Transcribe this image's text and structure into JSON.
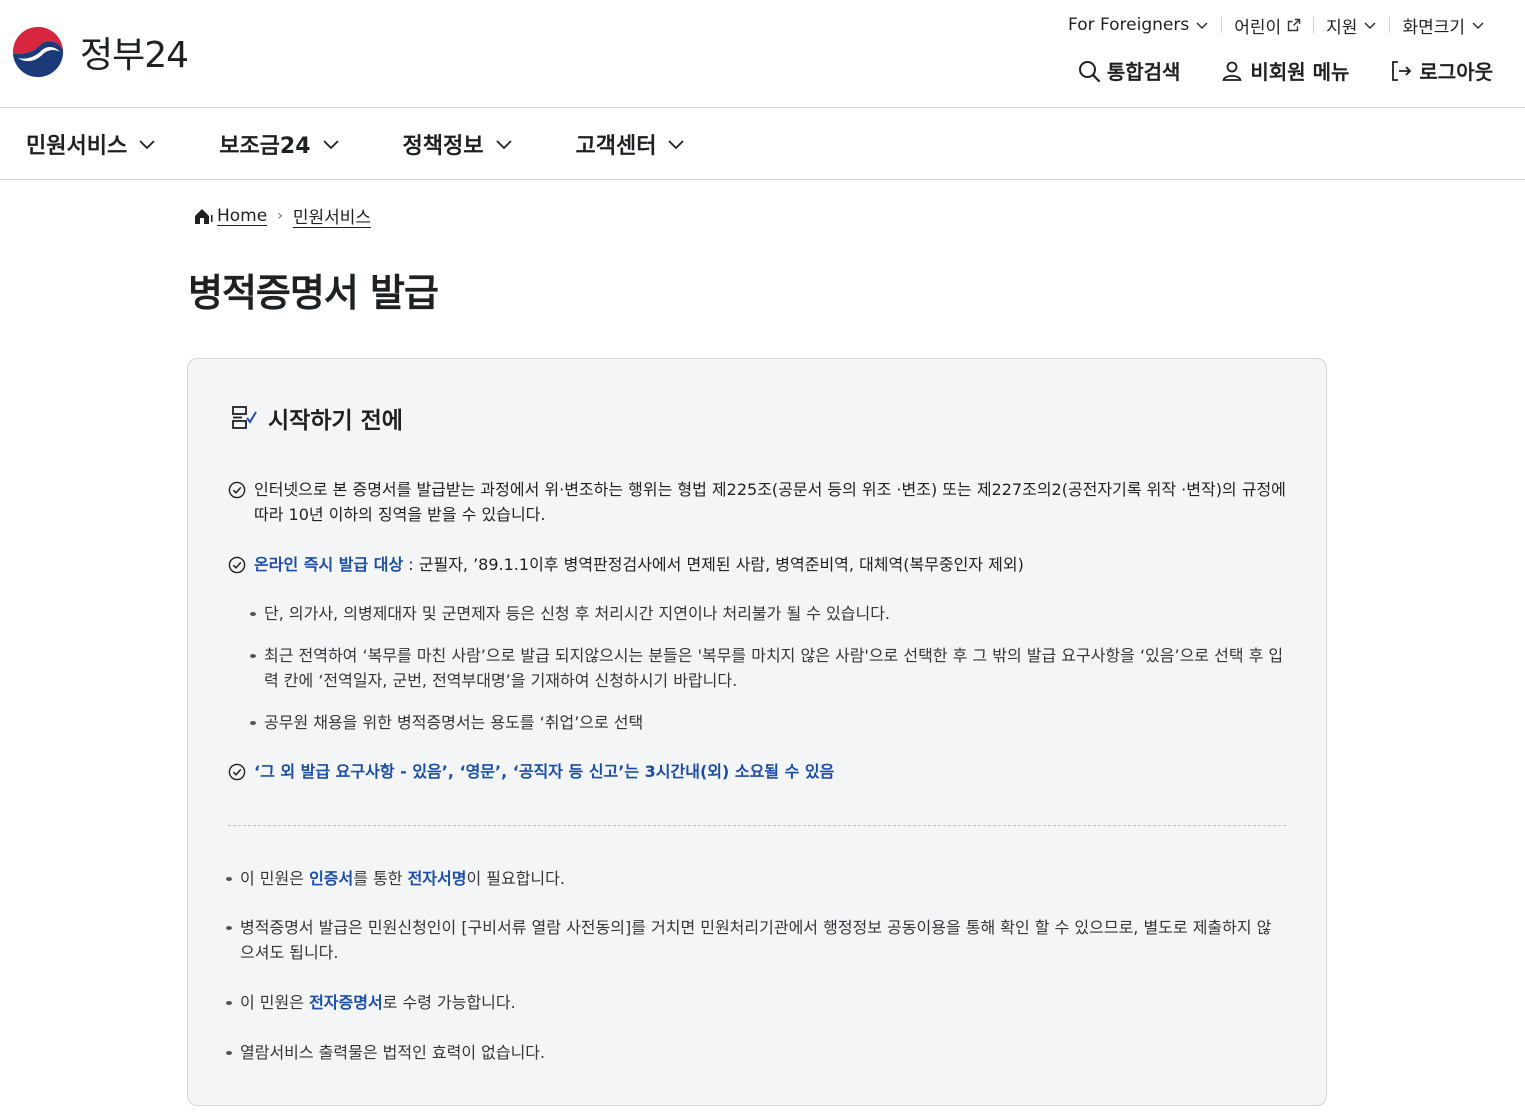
{
  "header": {
    "logo_text": "정부24",
    "util": [
      {
        "label": "For Foreigners"
      },
      {
        "label": "어린이"
      },
      {
        "label": "지원"
      },
      {
        "label": "화면크기"
      }
    ],
    "actions": {
      "search": "통합검색",
      "guest_menu": "비회원 메뉴",
      "logout": "로그아웃"
    }
  },
  "main_nav": [
    {
      "label": "민원서비스"
    },
    {
      "label": "보조금24"
    },
    {
      "label": "정책정보"
    },
    {
      "label": "고객센터"
    }
  ],
  "breadcrumb": {
    "home": "Home",
    "current": "민원서비스"
  },
  "page_title": "병적증명서 발급",
  "box": {
    "heading": "시작하기 전에",
    "item1": "인터넷으로 본 증명서를 발급받는 과정에서 위·변조하는 행위는 형법 제225조(공문서 등의 위조 ·변조) 또는 제227조의2(공전자기록 위작 ·변작)의 규정에 따라 10년 이하의 징역을 받을 수 있습니다.",
    "item2_highlight": "온라인 즉시 발급 대상",
    "item2_rest": " : 군필자, ’89.1.1이후 병역판정검사에서 면제된 사람, 병역준비역, 대체역(복무중인자 제외)",
    "sub1": "단, 의가사, 의병제대자 및 군면제자 등은 신청 후 처리시간 지연이나 처리불가 될 수 있습니다.",
    "sub2": "최근 전역하여 ‘복무를 마친 사람’으로 발급 되지않으시는 분들은 '복무를 마치지 않은 사람'으로 선택한 후 그 밖의 발급 요구사항을 ‘있음’으로 선택 후 입력 칸에 ‘전역일자, 군번, 전역부대명’을 기재하여 신청하시기 바랍니다.",
    "sub3": "공무원 채용을 위한 병적증명서는 용도를 ‘취업’으로 선택",
    "item3": "‘그 외 발급 요구사항 - 있음’, ‘영문’, ‘공직자 등 신고’는 3시간내(외) 소요될 수 있음",
    "note1_a": "이 민원은 ",
    "note1_b": "인증서",
    "note1_c": "를 통한 ",
    "note1_d": "전자서명",
    "note1_e": "이 필요합니다.",
    "note2": "병적증명서 발급은 민원신청인이 [구비서류 열람 사전동의]를 거치면 민원처리기관에서 행정정보 공동이용을 통해 확인 할 수 있으므로, 별도로 제출하지 않으셔도 됩니다.",
    "note3_a": "이 민원은 ",
    "note3_b": "전자증명서",
    "note3_c": "로 수령 가능합니다.",
    "note4": "열람서비스 출력물은 법적인 효력이 없습니다."
  },
  "colors": {
    "accent": "#1b4ea8",
    "logo_red": "#d7263d",
    "logo_blue": "#1a3a7a",
    "box_bg": "#f4f5f6"
  }
}
